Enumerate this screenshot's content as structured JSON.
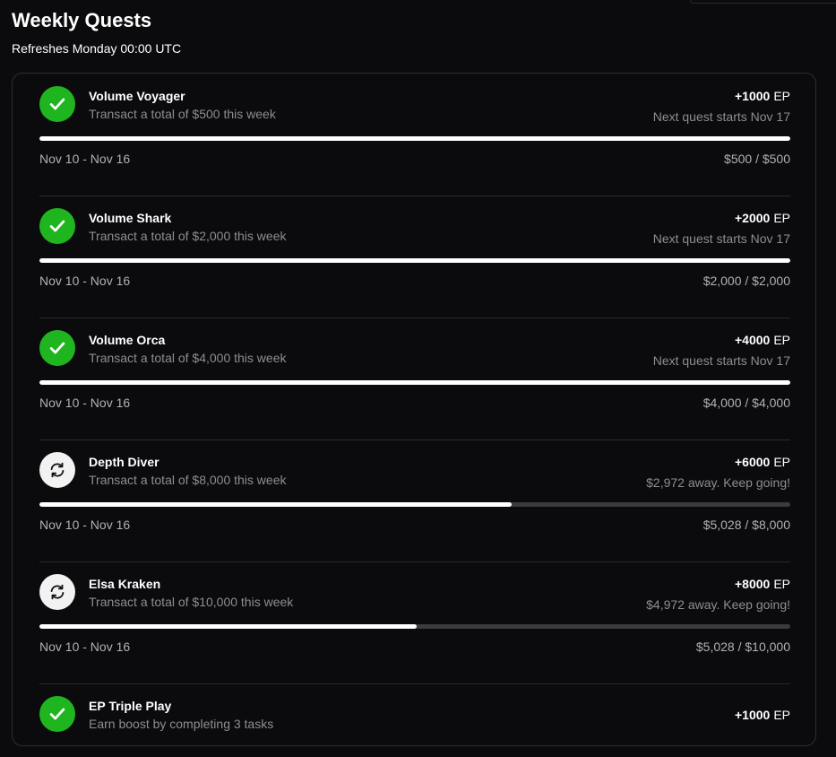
{
  "page": {
    "title": "Weekly Quests",
    "subtitle": "Refreshes Monday 00:00 UTC"
  },
  "colors": {
    "background": "#0b0b0d",
    "complete_green": "#1fb51f",
    "pending_icon_bg": "#f2f2f2",
    "progress_fill": "#ffffff",
    "progress_track": "#3a3a3f",
    "muted_text": "#8d8d93"
  },
  "quests": [
    {
      "name": "Volume Voyager",
      "description": "Transact a total of $500 this week",
      "reward": "+1000",
      "reward_unit": "EP",
      "hint": "Next quest starts Nov 17",
      "status": "complete",
      "icon": "check-icon",
      "progress": 1.0,
      "date_range": "Nov 10 - Nov 16",
      "amount": "$500 / $500"
    },
    {
      "name": "Volume Shark",
      "description": "Transact a total of $2,000 this week",
      "reward": "+2000",
      "reward_unit": "EP",
      "hint": "Next quest starts Nov 17",
      "status": "complete",
      "icon": "check-icon",
      "progress": 1.0,
      "date_range": "Nov 10 - Nov 16",
      "amount": "$2,000 / $2,000"
    },
    {
      "name": "Volume Orca",
      "description": "Transact a total of $4,000 this week",
      "reward": "+4000",
      "reward_unit": "EP",
      "hint": "Next quest starts Nov 17",
      "status": "complete",
      "icon": "check-icon",
      "progress": 1.0,
      "date_range": "Nov 10 - Nov 16",
      "amount": "$4,000 / $4,000"
    },
    {
      "name": "Depth Diver",
      "description": "Transact a total of $8,000 this week",
      "reward": "+6000",
      "reward_unit": "EP",
      "hint": "$2,972 away. Keep going!",
      "status": "in-progress",
      "icon": "refresh-icon",
      "progress": 0.6285,
      "date_range": "Nov 10 - Nov 16",
      "amount": "$5,028 / $8,000"
    },
    {
      "name": "Elsa Kraken",
      "description": "Transact a total of $10,000 this week",
      "reward": "+8000",
      "reward_unit": "EP",
      "hint": "$4,972 away. Keep going!",
      "status": "in-progress",
      "icon": "refresh-icon",
      "progress": 0.5028,
      "date_range": "Nov 10 - Nov 16",
      "amount": "$5,028 / $10,000"
    },
    {
      "name": "EP Triple Play",
      "description": "Earn boost by completing 3 tasks",
      "reward": "+1000",
      "reward_unit": "EP",
      "status": "complete",
      "icon": "check-icon"
    }
  ]
}
